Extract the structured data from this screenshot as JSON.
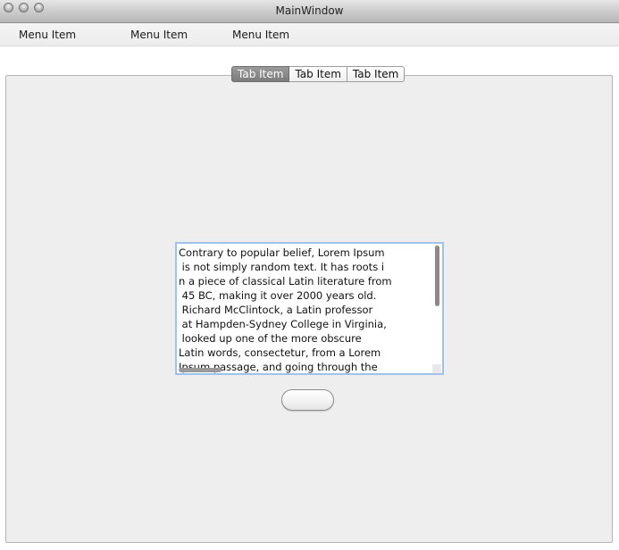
{
  "window": {
    "title": "MainWindow"
  },
  "menubar": {
    "items": [
      {
        "label": "Menu Item"
      },
      {
        "label": "Menu Item"
      },
      {
        "label": "Menu Item"
      }
    ]
  },
  "tabs": {
    "items": [
      {
        "label": "Tab Item",
        "selected": true
      },
      {
        "label": "Tab Item",
        "selected": false
      },
      {
        "label": "Tab Item",
        "selected": false
      }
    ]
  },
  "textbox": {
    "text": "Contrary to popular belief, Lorem Ipsum\n is not simply random text. It has roots i\nn a piece of classical Latin literature from\n 45 BC, making it over 2000 years old.\n Richard McClintock, a Latin professor\n at Hampden-Sydney College in Virginia,\n looked up one of the more obscure\nLatin words, consectetur, from a Lorem\nIpsum passage, and going through the"
  },
  "button": {
    "label": ""
  },
  "colors": {
    "selected_tab": "#7b7b7b",
    "textbox_focus_border": "#9ec2ea",
    "panel_background": "#efeeef"
  }
}
